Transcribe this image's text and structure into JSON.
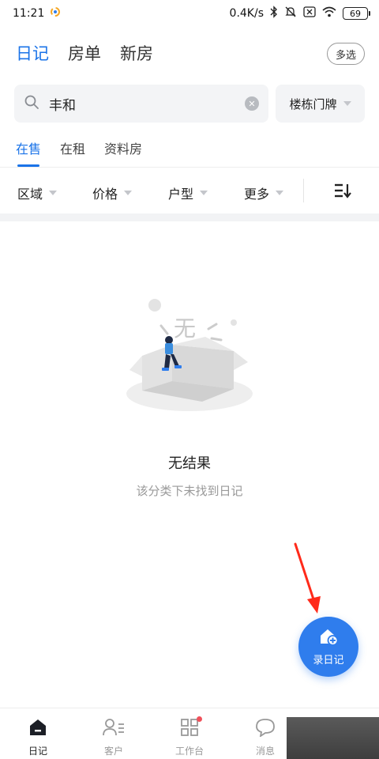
{
  "status_bar": {
    "time": "11:21",
    "network_speed": "0.4K/s",
    "battery": "69"
  },
  "top_tabs": [
    {
      "label": "日记",
      "active": true
    },
    {
      "label": "房单",
      "active": false
    },
    {
      "label": "新房",
      "active": false
    }
  ],
  "multi_select_label": "多选",
  "search": {
    "query": "丰和",
    "building_select": "楼栋门牌"
  },
  "sub_tabs": [
    {
      "label": "在售",
      "active": true
    },
    {
      "label": "在租",
      "active": false
    },
    {
      "label": "资料房",
      "active": false
    }
  ],
  "filters": [
    {
      "label": "区域"
    },
    {
      "label": "价格"
    },
    {
      "label": "户型"
    },
    {
      "label": "更多"
    }
  ],
  "empty_state": {
    "illustration_text": "无",
    "title": "无结果",
    "subtitle": "该分类下未找到日记"
  },
  "fab": {
    "label": "录日记"
  },
  "bottom_nav": [
    {
      "label": "日记",
      "icon": "diary-icon",
      "active": true
    },
    {
      "label": "客户",
      "icon": "customer-icon",
      "active": false
    },
    {
      "label": "工作台",
      "icon": "workbench-icon",
      "active": false,
      "badge": true
    },
    {
      "label": "消息",
      "icon": "message-icon",
      "active": false
    }
  ],
  "colors": {
    "accent": "#1a73e8",
    "fab": "#2f7ded",
    "arrow": "#ff2a1a",
    "badge": "#f0505a"
  }
}
